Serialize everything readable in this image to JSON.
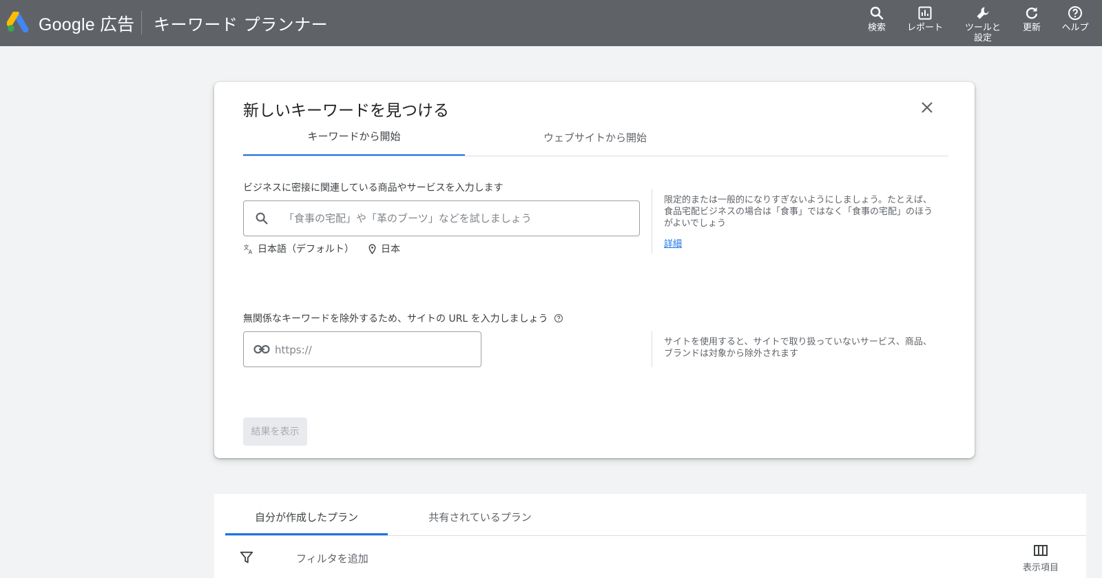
{
  "header": {
    "brand": "Google 広告",
    "product": "キーワード プランナー",
    "nav": [
      {
        "label": "検索",
        "icon": "search-icon"
      },
      {
        "label": "レポート",
        "icon": "report-icon"
      },
      {
        "label": "ツールと\n設定",
        "icon": "wrench-icon"
      },
      {
        "label": "更新",
        "icon": "refresh-icon"
      },
      {
        "label": "ヘルプ",
        "icon": "help-icon"
      }
    ]
  },
  "dialog": {
    "title": "新しいキーワードを見つける",
    "tabs": [
      {
        "label": "キーワードから開始",
        "active": true
      },
      {
        "label": "ウェブサイトから開始",
        "active": false
      }
    ],
    "keywords": {
      "label": "ビジネスに密接に関連している商品やサービスを入力します",
      "value": "",
      "placeholder": "「食事の宅配」や「革のブーツ」などを試しましょう",
      "language": "日本語（デフォルト）",
      "location": "日本",
      "help_text": "限定的または一般的になりすぎないようにしましょう。たとえば、食品宅配ビジネスの場合は「食事」ではなく「食事の宅配」のほうがよいでしょう",
      "help_link": "詳細"
    },
    "site": {
      "label": "無関係なキーワードを除外するため、サイトの URL を入力しましょう",
      "value": "",
      "placeholder": "https://",
      "help_text": "サイトを使用すると、サイトで取り扱っていないサービス、商品、ブランドは対象から除外されます"
    },
    "submit_label": "結果を表示"
  },
  "plans": {
    "tabs": [
      {
        "label": "自分が作成したプラン",
        "active": true
      },
      {
        "label": "共有されているプラン",
        "active": false
      }
    ],
    "filter_label": "フィルタを追加",
    "columns_label": "表示項目"
  },
  "colors": {
    "topbar": "#5f6368",
    "accent": "#1a73e8",
    "background": "#f1f3f4"
  }
}
